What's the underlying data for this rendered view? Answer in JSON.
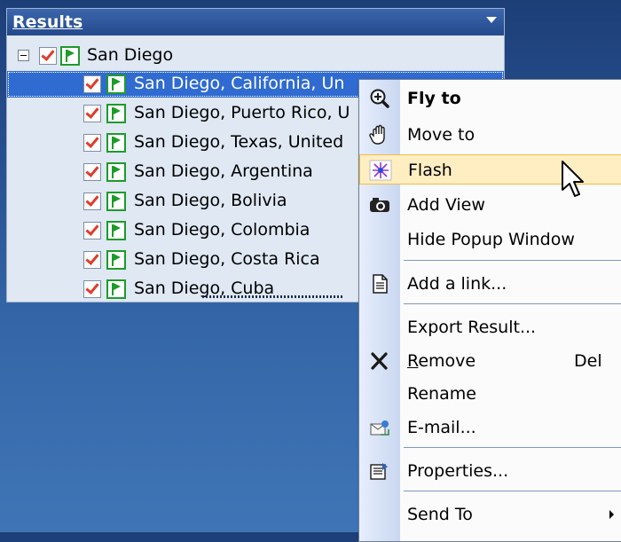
{
  "panel": {
    "title": "Results",
    "group": {
      "label": "San Diego"
    },
    "items": [
      {
        "label": "San Diego, California, Un",
        "selected": true
      },
      {
        "label": "San Diego, Puerto Rico, U"
      },
      {
        "label": "San Diego, Texas, United"
      },
      {
        "label": "San Diego, Argentina"
      },
      {
        "label": "San Diego, Bolivia"
      },
      {
        "label": "San Diego, Colombia"
      },
      {
        "label": "San Diego, Costa Rica"
      },
      {
        "label": "San Diego, Cuba"
      }
    ]
  },
  "menu": {
    "items": [
      {
        "label": "Fly to",
        "icon": "zoom-icon",
        "bold": true
      },
      {
        "label": "Move to",
        "icon": "hand-icon"
      },
      {
        "label": "Flash",
        "icon": "flash-icon",
        "highlighted": true
      },
      {
        "label": "Add View",
        "icon": "camera-icon"
      },
      {
        "label": "Hide Popup Window"
      },
      {
        "label": "Add a link...",
        "icon": "document-icon"
      },
      {
        "label": "Export Result..."
      },
      {
        "label": "Remove",
        "icon": "delete-icon",
        "shortcut": "Del"
      },
      {
        "label": "Rename"
      },
      {
        "label": "E-mail...",
        "icon": "email-icon"
      },
      {
        "label": "Properties...",
        "icon": "properties-icon"
      },
      {
        "label": "Send To",
        "submenu": true
      }
    ]
  },
  "colors": {
    "selection": "#2f6bd0",
    "header": "#2c56a0",
    "menu_highlight": "#ffeec2",
    "check": "#e03b2b",
    "flag": "#1d9b2a"
  }
}
